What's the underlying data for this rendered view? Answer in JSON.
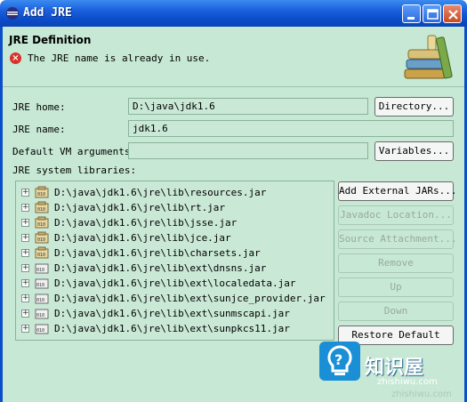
{
  "window": {
    "title": "Add JRE"
  },
  "header": {
    "title": "JRE Definition",
    "error_message": "The JRE name is already in use."
  },
  "form": {
    "jre_home_label": "JRE home:",
    "jre_home_value": "D:\\java\\jdk1.6",
    "directory_button": "Directory...",
    "jre_name_label": "JRE name:",
    "jre_name_value": "jdk1.6",
    "vm_args_label": "Default VM arguments:",
    "vm_args_value": "",
    "variables_button": "Variables...",
    "libraries_label": "JRE system libraries:"
  },
  "libraries": [
    "D:\\java\\jdk1.6\\jre\\lib\\resources.jar",
    "D:\\java\\jdk1.6\\jre\\lib\\rt.jar",
    "D:\\java\\jdk1.6\\jre\\lib\\jsse.jar",
    "D:\\java\\jdk1.6\\jre\\lib\\jce.jar",
    "D:\\java\\jdk1.6\\jre\\lib\\charsets.jar",
    "D:\\java\\jdk1.6\\jre\\lib\\ext\\dnsns.jar",
    "D:\\java\\jdk1.6\\jre\\lib\\ext\\localedata.jar",
    "D:\\java\\jdk1.6\\jre\\lib\\ext\\sunjce_provider.jar",
    "D:\\java\\jdk1.6\\jre\\lib\\ext\\sunmscapi.jar",
    "D:\\java\\jdk1.6\\jre\\lib\\ext\\sunpkcs11.jar"
  ],
  "side_buttons": {
    "add_external": "Add External JARs...",
    "javadoc": "Javadoc Location...",
    "source": "Source Attachment...",
    "remove": "Remove",
    "up": "Up",
    "down": "Down",
    "restore": "Restore Default"
  },
  "watermark": {
    "logo_text": "知识屋",
    "logo_url": "zhishiwu.com",
    "site_text": "zhishiwu.com"
  },
  "colors": {
    "titlebar": "#0b4ec9",
    "panel_bg": "#c6e8d4",
    "error": "#d8322a"
  }
}
